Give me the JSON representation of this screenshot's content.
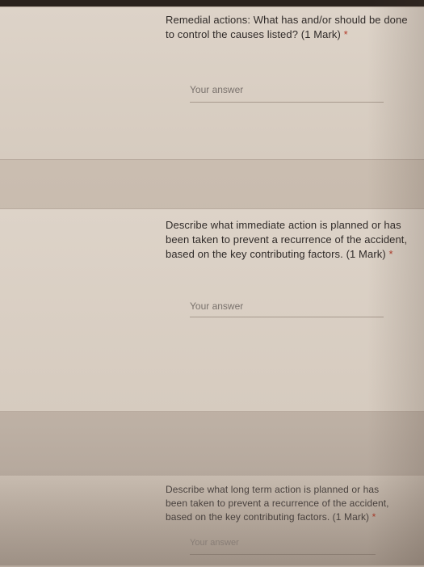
{
  "questions": [
    {
      "text": "Remedial actions: What has and/or should be done to control the causes listed? (1 Mark)",
      "required": "*",
      "answer_placeholder": "Your answer"
    },
    {
      "text": "Describe what immediate action is planned or has been taken to prevent a recurrence of the accident, based on the key contributing factors. (1 Mark)",
      "required": "*",
      "answer_placeholder": "Your answer"
    },
    {
      "text": "Describe what long term action is planned or has been taken to prevent a recurrence of the accident, based on the key contributing factors. (1 Mark)",
      "required": "*",
      "answer_placeholder": "Your answer"
    }
  ]
}
